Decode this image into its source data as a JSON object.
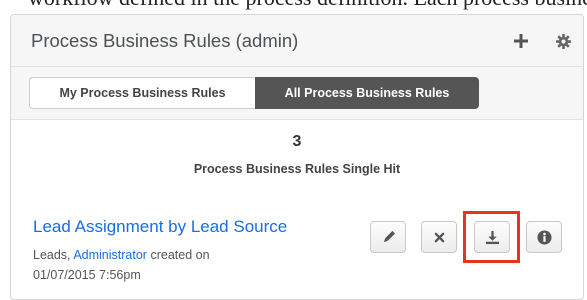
{
  "top_text": "workflow defined in the process definition. Each process business rule is defined by",
  "dashlet": {
    "title": "Process Business Rules (admin)",
    "add_icon": "plus-icon",
    "settings_icon": "gear-icon"
  },
  "tabs": [
    {
      "label": "My Process Business Rules",
      "active": false
    },
    {
      "label": "All Process Business Rules",
      "active": true
    }
  ],
  "summary": {
    "count": "3",
    "label": "Process Business Rules Single Hit"
  },
  "record": {
    "name": "Lead Assignment by Lead Source",
    "module": "Leads,",
    "user": "Administrator",
    "created_label": "created on",
    "created_date": "01/07/2015 7:56pm"
  },
  "actions": [
    {
      "name": "edit",
      "icon": "pencil-icon"
    },
    {
      "name": "delete",
      "icon": "x-icon"
    },
    {
      "name": "export",
      "icon": "download-icon",
      "highlighted": true
    },
    {
      "name": "info",
      "icon": "info-icon"
    }
  ],
  "colors": {
    "link": "#176de5",
    "active_tab_bg": "#555555",
    "highlight": "#e8341c"
  }
}
